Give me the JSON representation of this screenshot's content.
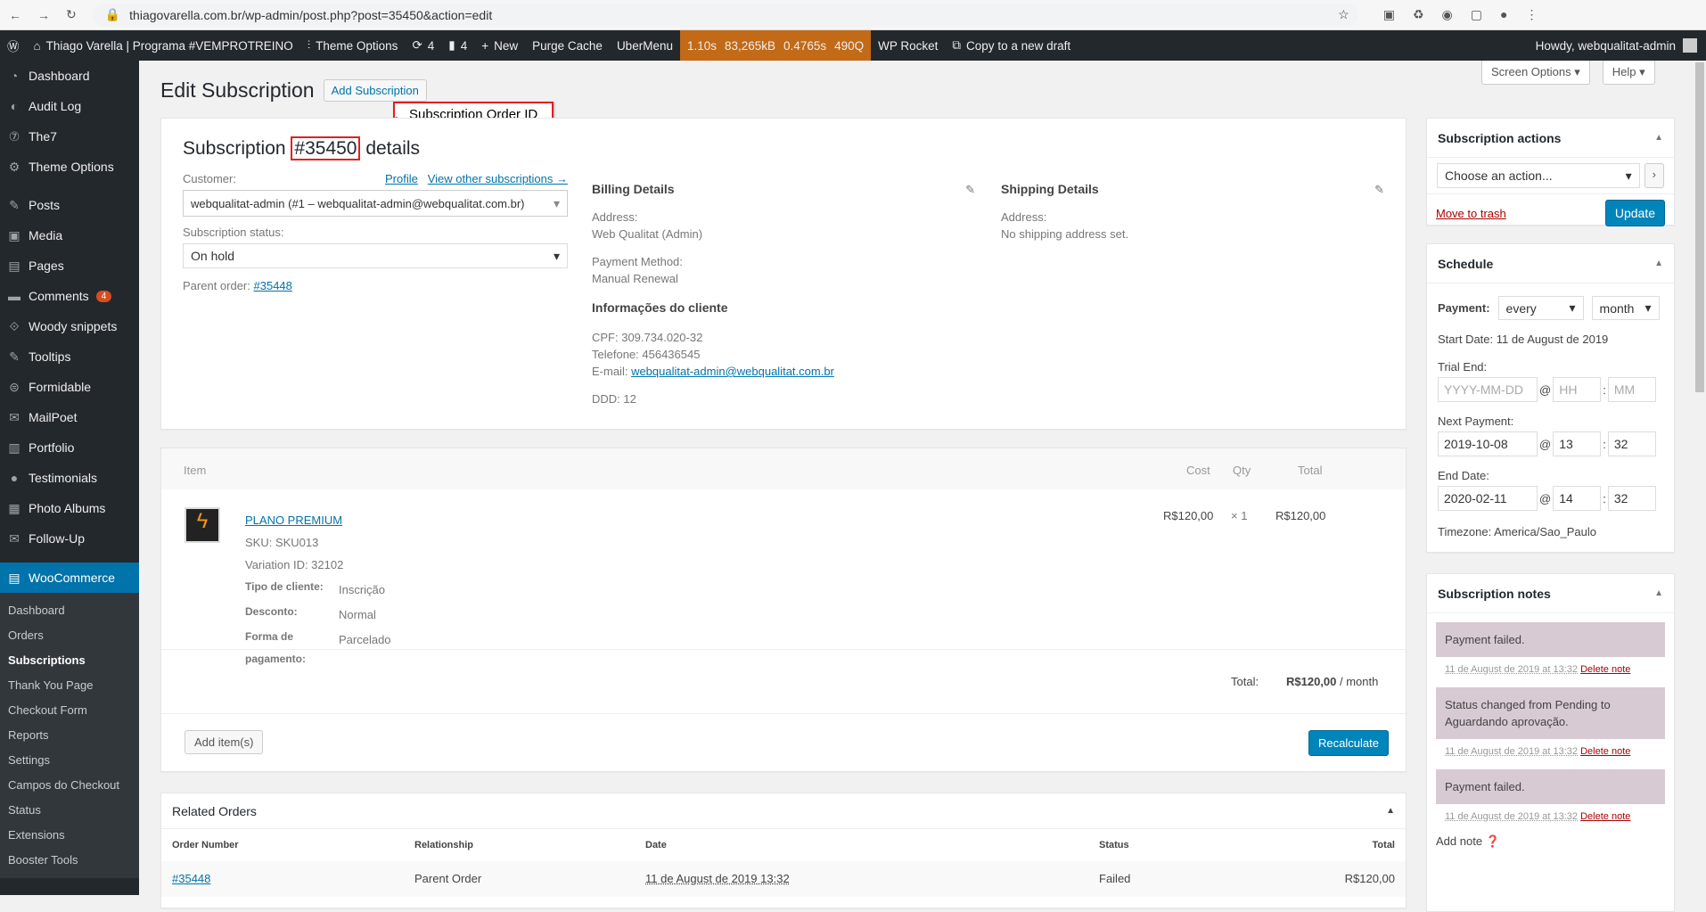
{
  "browser": {
    "url": "thiagovarella.com.br/wp-admin/post.php?post=35450&action=edit"
  },
  "adminbar": {
    "site": "Thiago Varella | Programa #VEMPROTREINO",
    "theme_options": "Theme Options",
    "updates": "4",
    "comments": "4",
    "new": "New",
    "purge": "Purge Cache",
    "ubermenu": "UberMenu",
    "perf": [
      "1.10s",
      "83,265kB",
      "0.4765s",
      "490Q"
    ],
    "rocket": "WP Rocket",
    "copy": "Copy to a new draft",
    "howdy": "Howdy, webqualitat-admin"
  },
  "sidebar": {
    "items": [
      {
        "label": "Dashboard",
        "icon": "dashboard-icon"
      },
      {
        "label": "Audit Log",
        "icon": "audit-icon"
      },
      {
        "label": "The7",
        "icon": "the7-icon"
      },
      {
        "label": "Theme Options",
        "icon": "gear-icon"
      },
      {
        "label": "Posts",
        "icon": "pin-icon"
      },
      {
        "label": "Media",
        "icon": "media-icon"
      },
      {
        "label": "Pages",
        "icon": "page-icon"
      },
      {
        "label": "Comments",
        "icon": "comment-icon",
        "badge": "4"
      },
      {
        "label": "Woody snippets",
        "icon": "snippet-icon"
      },
      {
        "label": "Tooltips",
        "icon": "pin-icon"
      },
      {
        "label": "Formidable",
        "icon": "form-icon"
      },
      {
        "label": "MailPoet",
        "icon": "mail-icon"
      },
      {
        "label": "Portfolio",
        "icon": "portfolio-icon"
      },
      {
        "label": "Testimonials",
        "icon": "chat-icon"
      },
      {
        "label": "Photo Albums",
        "icon": "album-icon"
      },
      {
        "label": "Follow-Up",
        "icon": "mail-icon"
      }
    ],
    "woo": "WooCommerce",
    "sub": [
      "Dashboard",
      "Orders",
      "Subscriptions",
      "Thank You Page",
      "Checkout Form",
      "Reports",
      "Settings",
      "Campos do Checkout",
      "Status",
      "Extensions",
      "Booster Tools"
    ]
  },
  "header": {
    "title": "Edit Subscription",
    "add": "Add Subscription",
    "screen_options": "Screen Options",
    "help": "Help",
    "annotation": "Subscription Order ID"
  },
  "details": {
    "prefix": "Subscription ",
    "id": "#35450",
    "suffix": " details",
    "customer_label": "Customer:",
    "profile": "Profile",
    "view_other": "View other subscriptions →",
    "customer": "webqualitat-admin (#1 – webqualitat-admin@webqualitat.com.br)",
    "status_label": "Subscription status:",
    "status": "On hold",
    "parent_label": "Parent order: ",
    "parent": "#35448",
    "billing": {
      "title": "Billing Details",
      "address_label": "Address:",
      "address": "Web Qualitat (Admin)",
      "pm_label": "Payment Method:",
      "pm": "Manual Renewal",
      "info_title": "Informações do cliente",
      "cpf": "CPF: 309.734.020-32",
      "tel": "Telefone: 456436545",
      "email_label": "E-mail: ",
      "email": "webqualitat-admin@webqualitat.com.br",
      "ddd": "DDD: 12"
    },
    "shipping": {
      "title": "Shipping Details",
      "address_label": "Address:",
      "address": "No shipping address set."
    }
  },
  "items": {
    "headers": [
      "Item",
      "Cost",
      "Qty",
      "Total"
    ],
    "name": "PLANO PREMIUM",
    "sku": "SKU: SKU013",
    "variation": "Variation ID: 32102",
    "meta": [
      {
        "k": "Tipo de cliente:",
        "v": "Inscrição"
      },
      {
        "k": "Desconto:",
        "v": "Normal"
      },
      {
        "k": "Forma de pagamento:",
        "v": "Parcelado"
      }
    ],
    "cost": "R$120,00",
    "qty": "× 1",
    "total": "R$120,00",
    "total_label": "Total:",
    "grand": "R$120,00",
    "per": " / month",
    "add": "Add item(s)",
    "recalc": "Recalculate"
  },
  "related": {
    "title": "Related Orders",
    "headers": [
      "Order Number",
      "Relationship",
      "Date",
      "Status",
      "Total"
    ],
    "row": {
      "num": "#35448",
      "rel": "Parent Order",
      "date": "11 de August de 2019 13:32",
      "status": "Failed",
      "total": "R$120,00"
    }
  },
  "actions": {
    "title": "Subscription actions",
    "select": "Choose an action...",
    "trash": "Move to trash",
    "update": "Update"
  },
  "schedule": {
    "title": "Schedule",
    "payment_label": "Payment:",
    "every": "every",
    "period": "month",
    "start": "Start Date: 11 de August de 2019",
    "trial_label": "Trial End:",
    "trial_ph": [
      "YYYY-MM-DD",
      "HH",
      "MM"
    ],
    "next_label": "Next Payment:",
    "next": [
      "2019-10-08",
      "13",
      "32"
    ],
    "end_label": "End Date:",
    "end": [
      "2020-02-11",
      "14",
      "32"
    ],
    "tz": "Timezone: America/Sao_Paulo"
  },
  "notes": {
    "title": "Subscription notes",
    "list": [
      {
        "text": "Payment failed.",
        "meta": "11 de August de 2019 at 13:32"
      },
      {
        "text": "Status changed from Pending to Aguardando aprovação.",
        "meta": "11 de August de 2019 at 13:32"
      },
      {
        "text": "Payment failed.",
        "meta": "11 de August de 2019 at 13:32"
      }
    ],
    "delete": "Delete note",
    "add": "Add note"
  },
  "colors": {
    "accent": "#0073aa",
    "woo": "#0073aa",
    "annotation": "#e02020",
    "perf": "#c26a17"
  }
}
